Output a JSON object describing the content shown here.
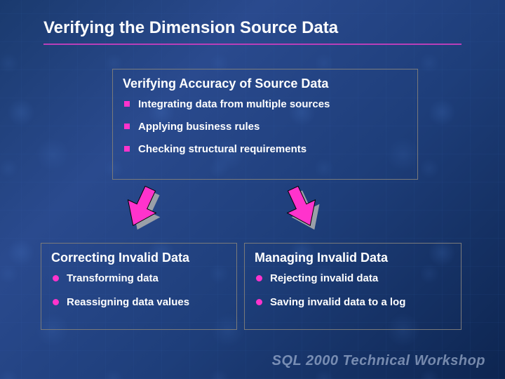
{
  "title": "Verifying the Dimension Source Data",
  "topBox": {
    "heading": "Verifying Accuracy of Source Data",
    "items": [
      "Integrating data from multiple sources",
      "Applying business rules",
      "Checking structural requirements"
    ]
  },
  "leftBox": {
    "heading": "Correcting Invalid Data",
    "items": [
      "Transforming data",
      "Reassigning data values"
    ]
  },
  "rightBox": {
    "heading": "Managing Invalid Data",
    "items": [
      "Rejecting invalid data",
      "Saving invalid data to a log"
    ]
  },
  "footer": "SQL 2000 Technical Workshop",
  "colors": {
    "accent": "#ff33cc",
    "rule": "#b93fb9"
  }
}
